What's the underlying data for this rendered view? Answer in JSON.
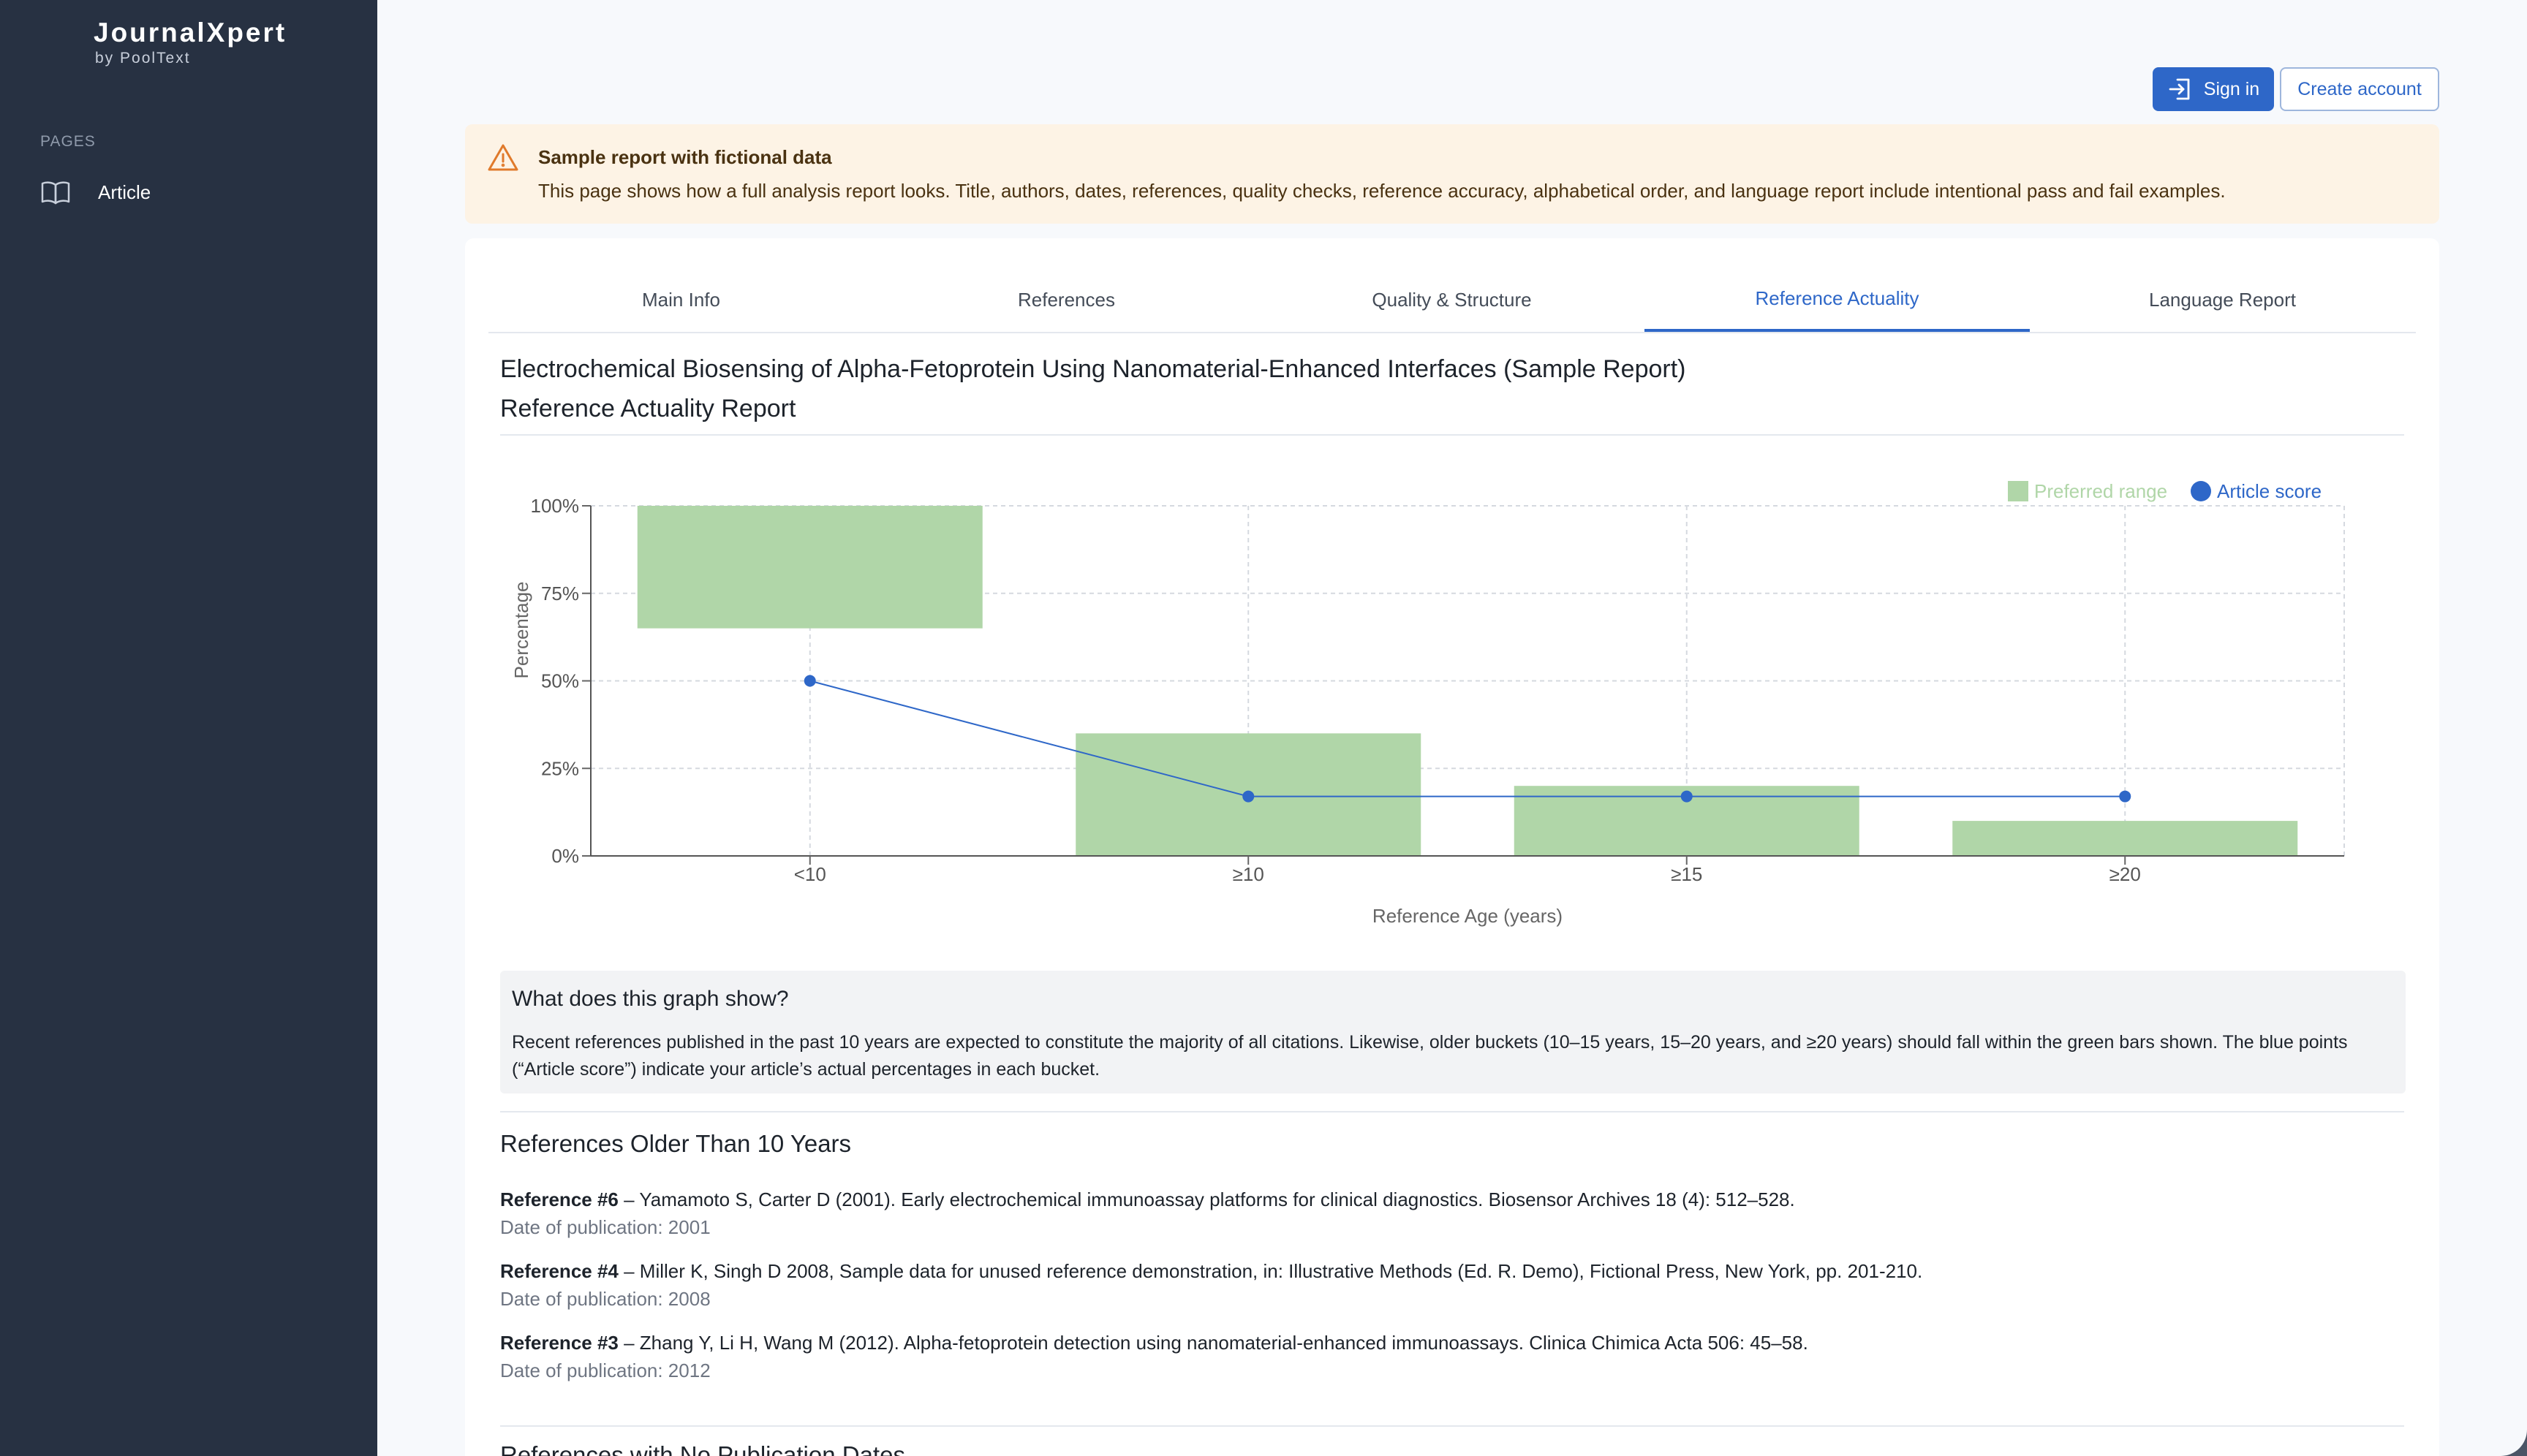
{
  "sidebar": {
    "brand_title": "JournalXpert",
    "brand_sub": "by PoolText",
    "section_label": "PAGES",
    "items": [
      {
        "label": "Article",
        "icon": "book-open-icon"
      }
    ]
  },
  "auth": {
    "sign_in": "Sign in",
    "create_account": "Create account"
  },
  "notice": {
    "title": "Sample report with fictional data",
    "text": "This page shows how a full analysis report looks. Title, authors, dates, references, quality checks, reference accuracy, alphabetical order, and language report include intentional pass and fail examples."
  },
  "tabs": [
    {
      "label": "Main Info",
      "active": false
    },
    {
      "label": "References",
      "active": false
    },
    {
      "label": "Quality & Structure",
      "active": false
    },
    {
      "label": "Reference Actuality",
      "active": true
    },
    {
      "label": "Language Report",
      "active": false
    }
  ],
  "report": {
    "doc_title": "Electrochemical Biosensing of Alpha-Fetoprotein Using Nanomaterial-Enhanced Interfaces (Sample Report)",
    "report_title": "Reference Actuality Report"
  },
  "chart_data": {
    "type": "bar",
    "categories": [
      "<10",
      "≥10",
      "≥15",
      "≥20"
    ],
    "series": [
      {
        "name": "Preferred range",
        "kind": "floating-bar",
        "low": [
          65,
          0,
          0,
          0
        ],
        "high": [
          100,
          35,
          20,
          10
        ],
        "color": "#b0d6a8"
      },
      {
        "name": "Article score",
        "kind": "line",
        "values": [
          50,
          17,
          17,
          17
        ],
        "color": "#2e67c8"
      }
    ],
    "xlabel": "Reference Age (years)",
    "ylabel": "Percentage",
    "ylim": [
      0,
      100
    ],
    "yticks": [
      "0%",
      "25%",
      "50%",
      "75%",
      "100%"
    ],
    "grid": true,
    "legend": "top-right"
  },
  "explain": {
    "title": "What does this graph show?",
    "text": "Recent references published in the past 10 years are expected to constitute the majority of all citations. Likewise, older buckets (10–15 years, 15–20 years, and ≥20 years) should fall within the green bars shown. The blue points (“Article score”) indicate your article’s actual percentages in each bucket."
  },
  "older_refs": {
    "title": "References Older Than 10 Years",
    "items": [
      {
        "label": "Reference #6",
        "text": " – Yamamoto S, Carter D (2001). Early electrochemical immunoassay platforms for clinical diagnostics. Biosensor Archives 18 (4): 512–528.",
        "date": "Date of publication: 2001"
      },
      {
        "label": "Reference #4",
        "text": " – Miller K, Singh D 2008, Sample data for unused reference demonstration, in: Illustrative Methods (Ed. R. Demo), Fictional Press, New York, pp. 201-210.",
        "date": "Date of publication: 2008"
      },
      {
        "label": "Reference #3",
        "text": " – Zhang Y, Li H, Wang M (2012). Alpha-fetoprotein detection using nanomaterial-enhanced immunoassays. Clinica Chimica Acta 506: 45–58.",
        "date": "Date of publication: 2012"
      }
    ]
  },
  "no_dates": {
    "title": "References with No Publication Dates"
  }
}
